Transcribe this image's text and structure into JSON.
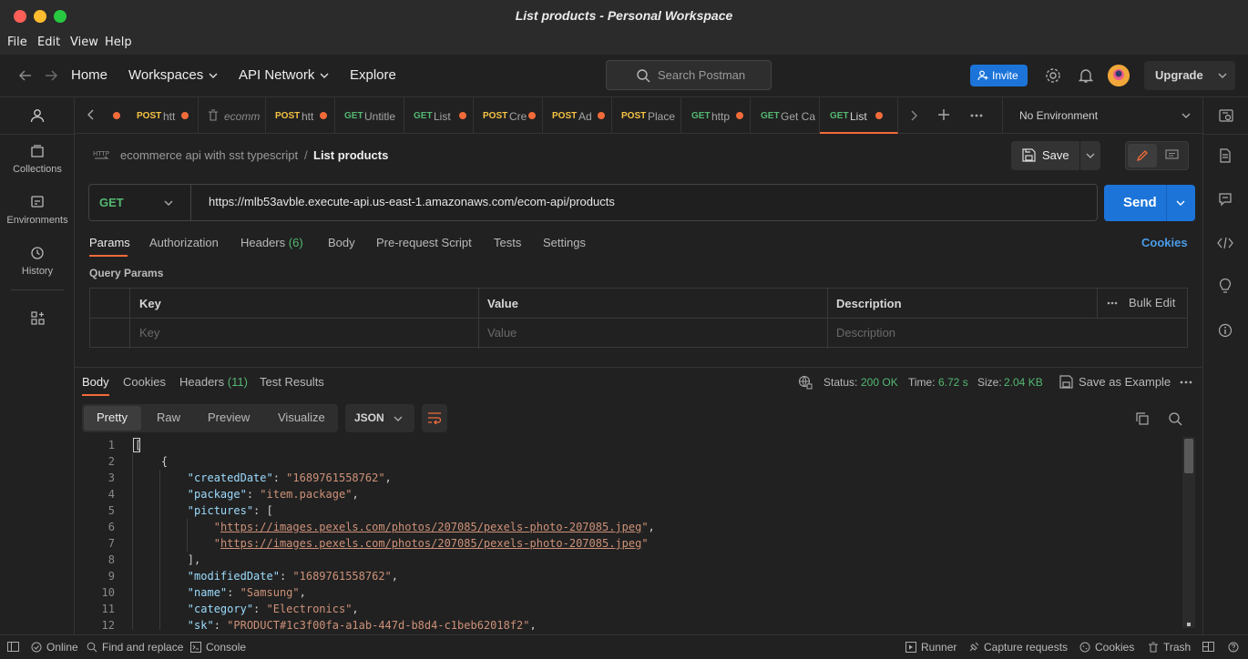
{
  "window": {
    "title": "List products - Personal Workspace"
  },
  "menu": [
    "File",
    "Edit",
    "View",
    "Help"
  ],
  "header": {
    "home": "Home",
    "workspaces": "Workspaces",
    "api_network": "API Network",
    "explore": "Explore",
    "search_placeholder": "Search Postman",
    "invite": "Invite",
    "upgrade": "Upgrade"
  },
  "sidebar": [
    {
      "label": "Collections",
      "icon": "collections-icon"
    },
    {
      "label": "Environments",
      "icon": "environments-icon"
    },
    {
      "label": "History",
      "icon": "history-icon"
    }
  ],
  "tabs": [
    {
      "method": "POST",
      "name": "htt",
      "dot": true
    },
    {
      "method": "",
      "name": "ecomm",
      "dot": false
    },
    {
      "method": "POST",
      "name": "htt",
      "dot": true
    },
    {
      "method": "GET",
      "name": "Untitle",
      "dot": false
    },
    {
      "method": "GET",
      "name": "List",
      "dot": true
    },
    {
      "method": "POST",
      "name": "Cre",
      "dot": true
    },
    {
      "method": "POST",
      "name": "Ad",
      "dot": true
    },
    {
      "method": "POST",
      "name": "Place",
      "dot": false
    },
    {
      "method": "GET",
      "name": "http",
      "dot": true
    },
    {
      "method": "GET",
      "name": "Get Ca",
      "dot": false
    },
    {
      "method": "GET",
      "name": "List",
      "dot": true
    }
  ],
  "environment": "No Environment",
  "breadcrumb": {
    "collection": "ecommerce api with sst typescript",
    "separator": "/",
    "request": "List products"
  },
  "save": "Save",
  "request": {
    "method": "GET",
    "url": "https://mlb53avble.execute-api.us-east-1.amazonaws.com/ecom-api/products",
    "send": "Send"
  },
  "request_tabs": {
    "params": "Params",
    "authorization": "Authorization",
    "headers": "Headers",
    "headers_count": "(6)",
    "body": "Body",
    "prerequest": "Pre-request Script",
    "tests": "Tests",
    "settings": "Settings",
    "cookies": "Cookies"
  },
  "query_params": {
    "title": "Query Params",
    "headers": [
      "Key",
      "Value",
      "Description"
    ],
    "bulk_edit": "Bulk Edit",
    "placeholders": [
      "Key",
      "Value",
      "Description"
    ]
  },
  "response": {
    "tabs": {
      "body": "Body",
      "cookies": "Cookies",
      "headers": "Headers",
      "headers_count": "(11)",
      "test_results": "Test Results"
    },
    "status_label": "Status:",
    "status_value": "200 OK",
    "time_label": "Time:",
    "time_value": "6.72 s",
    "size_label": "Size:",
    "size_value": "2.04 KB",
    "save_example": "Save as Example",
    "views": [
      "Pretty",
      "Raw",
      "Preview",
      "Visualize"
    ],
    "format": "JSON"
  },
  "code_lines": [
    {
      "n": "1",
      "html": "["
    },
    {
      "n": "2",
      "html": "    {"
    },
    {
      "n": "3",
      "html": "        <span class=\"k\">\"createdDate\"</span>: <span class=\"s\">\"1689761558762\"</span>,"
    },
    {
      "n": "4",
      "html": "        <span class=\"k\">\"package\"</span>: <span class=\"s\">\"item.package\"</span>,"
    },
    {
      "n": "5",
      "html": "        <span class=\"k\">\"pictures\"</span>: ["
    },
    {
      "n": "6",
      "html": "            <span class=\"s\">\"</span><span class=\"u\">https://images.pexels.com/photos/207085/pexels-photo-207085.jpeg</span><span class=\"s\">\"</span>,"
    },
    {
      "n": "7",
      "html": "            <span class=\"s\">\"</span><span class=\"u\">https://images.pexels.com/photos/207085/pexels-photo-207085.jpeg</span><span class=\"s\">\"</span>"
    },
    {
      "n": "8",
      "html": "        ],"
    },
    {
      "n": "9",
      "html": "        <span class=\"k\">\"modifiedDate\"</span>: <span class=\"s\">\"1689761558762\"</span>,"
    },
    {
      "n": "10",
      "html": "        <span class=\"k\">\"name\"</span>: <span class=\"s\">\"Samsung\"</span>,"
    },
    {
      "n": "11",
      "html": "        <span class=\"k\">\"category\"</span>: <span class=\"s\">\"Electronics\"</span>,"
    },
    {
      "n": "12",
      "html": "        <span class=\"k\">\"sk\"</span>: <span class=\"s\">\"PRODUCT#1c3f00fa-a1ab-447d-b8d4-c1beb62018f2\"</span>,"
    }
  ],
  "statusbar": {
    "online": "Online",
    "find_replace": "Find and replace",
    "console": "Console",
    "runner": "Runner",
    "capture": "Capture requests",
    "cookies": "Cookies",
    "trash": "Trash"
  },
  "colors": {
    "accent": "#1c74d9",
    "get": "#54b872",
    "post": "#f6c344",
    "unsaved_dot": "#f26b3a",
    "active_tab_underline": "#f26b3a"
  }
}
